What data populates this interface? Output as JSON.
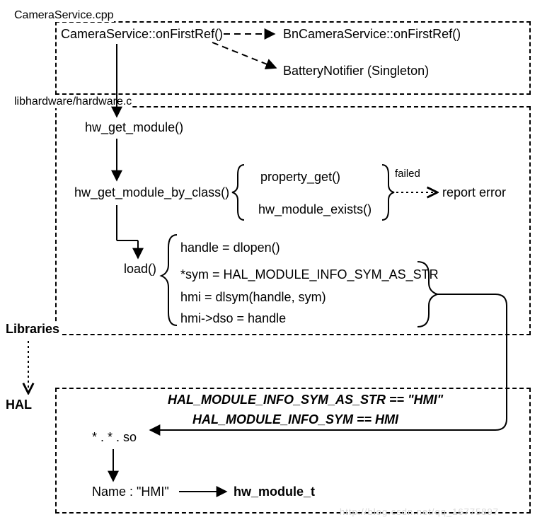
{
  "box1": {
    "title": "CameraService.cpp",
    "node_onFirstRef": "CameraService::onFirstRef()",
    "node_BnOnFirstRef": "BnCameraService::onFirstRef()",
    "node_BatteryNotifier": "BatteryNotifier (Singleton)"
  },
  "box2": {
    "title": "libhardware/hardware.c",
    "hw_get_module": "hw_get_module()",
    "hw_get_module_by_class": "hw_get_module_by_class()",
    "property_get": "property_get()",
    "hw_module_exists": "hw_module_exists()",
    "failed": "failed",
    "report_error": "report error",
    "load": "load()",
    "load_line1": "handle = dlopen()",
    "load_line2": "*sym = HAL_MODULE_INFO_SYM_AS_STR",
    "load_line3": "hmi = dlsym(handle, sym)",
    "load_line4": "hmi->dso = handle"
  },
  "side": {
    "libraries": "Libraries",
    "hal": "HAL"
  },
  "box3": {
    "hal_sym_str": "HAL_MODULE_INFO_SYM_AS_STR == \"HMI\"",
    "hal_sym": "HAL_MODULE_INFO_SYM == HMI",
    "so_file": "* . * . so",
    "name_hmi": "Name : \"HMI\"",
    "hw_module_t": "hw_module_t"
  },
  "watermark": "http://blog.csdn.net/qq_16775897"
}
